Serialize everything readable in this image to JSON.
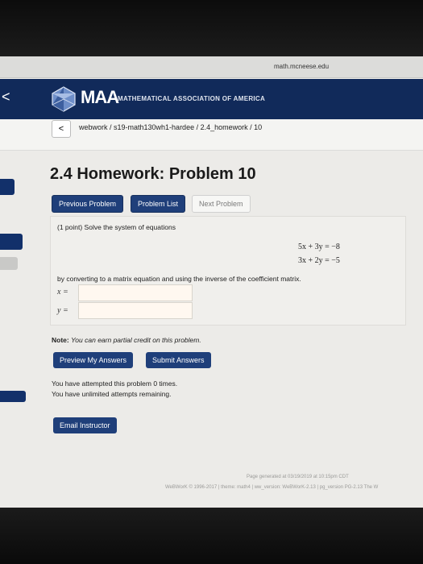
{
  "browser": {
    "url": "math.mcneese.edu"
  },
  "header": {
    "logo_text": "MAA",
    "logo_subtitle": "MATHEMATICAL ASSOCIATION OF AMERICA",
    "back_chevron": "<"
  },
  "breadcrumb": {
    "back": "<",
    "text": "webwork / s19-math130wh1-hardee / 2.4_homework / 10"
  },
  "page": {
    "title": "2.4 Homework: Problem 10"
  },
  "nav": {
    "previous": "Previous Problem",
    "list": "Problem List",
    "next": "Next Problem"
  },
  "problem": {
    "prompt": "(1 point) Solve the system of equations",
    "equations": [
      "5x + 3y = −8",
      "3x + 2y = −5"
    ],
    "instruction": "by converting to a matrix equation and using the inverse of the coefficient matrix.",
    "answers": [
      {
        "label": "x =",
        "value": ""
      },
      {
        "label": "y =",
        "value": ""
      }
    ]
  },
  "note": {
    "label": "Note:",
    "text": "You can earn partial credit on this problem."
  },
  "actions": {
    "preview": "Preview My Answers",
    "submit": "Submit Answers"
  },
  "attempts": {
    "line1": "You have attempted this problem 0 times.",
    "line2": "You have unlimited attempts remaining."
  },
  "email": {
    "label": "Email Instructor"
  },
  "footer": {
    "generated": "Page generated at 03/19/2019 at 10:15pm CDT",
    "version": "WeBWorK © 1996-2017 | theme: math4 | ww_version: WeBWorK-2.13 | pg_version PG-2.13 The W"
  },
  "colors": {
    "header": "#112a5a",
    "button": "#1f3f7a",
    "side_tab": "#12306a"
  }
}
